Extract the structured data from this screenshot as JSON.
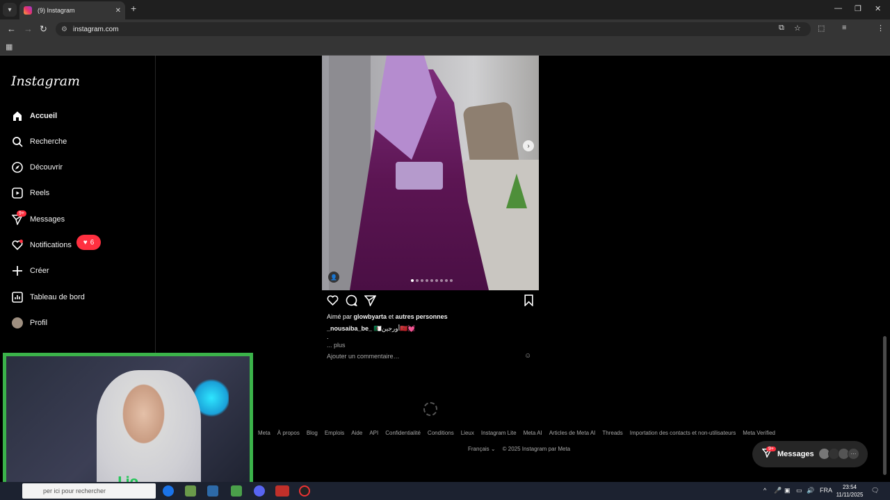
{
  "browser": {
    "tab_title": "(9) Instagram",
    "url": "instagram.com"
  },
  "sidebar": {
    "logo": "Instagram",
    "items": [
      {
        "label": "Accueil",
        "icon": "home-icon"
      },
      {
        "label": "Recherche",
        "icon": "search-icon"
      },
      {
        "label": "Découvrir",
        "icon": "compass-icon"
      },
      {
        "label": "Reels",
        "icon": "reels-icon"
      },
      {
        "label": "Messages",
        "icon": "messenger-icon",
        "badge": "9+"
      },
      {
        "label": "Notifications",
        "icon": "heart-icon"
      },
      {
        "label": "Créer",
        "icon": "plus-icon"
      },
      {
        "label": "Tableau de bord",
        "icon": "dashboard-icon"
      },
      {
        "label": "Profil",
        "icon": "avatar"
      }
    ],
    "notification_count": "6"
  },
  "post": {
    "liked_prefix": "Aimé par",
    "liked_user": "glowbyarta",
    "liked_and": "et",
    "liked_others": "autres personnes",
    "caption_user": "_nousaiba_be_",
    "caption_text": "🇩🇿أورجين🇲🇦💓",
    "caption_line2": ".",
    "more": "... plus",
    "comment_placeholder": "Ajouter un commentaire…",
    "carousel_total": 9,
    "carousel_current": 1
  },
  "footer": {
    "links": [
      "Meta",
      "À propos",
      "Blog",
      "Emplois",
      "Aide",
      "API",
      "Confidentialité",
      "Conditions",
      "Lieux",
      "Instagram Lite",
      "Meta AI",
      "Articles de Meta AI",
      "Threads",
      "Importation des contacts et non-utilisateurs",
      "Meta Verified"
    ],
    "language": "Français",
    "copyright": "© 2025 Instagram par Meta"
  },
  "messages_pill": {
    "label": "Messages",
    "badge": "9+"
  },
  "webcam": {
    "tag": "Lio"
  },
  "taskbar": {
    "search_placeholder": "per ici pour rechercher",
    "lang": "FRA",
    "time": "23:54",
    "date": "11/11/2025"
  },
  "colors": {
    "accent_red": "#ff3040",
    "webcam_border": "#3bb34a"
  }
}
